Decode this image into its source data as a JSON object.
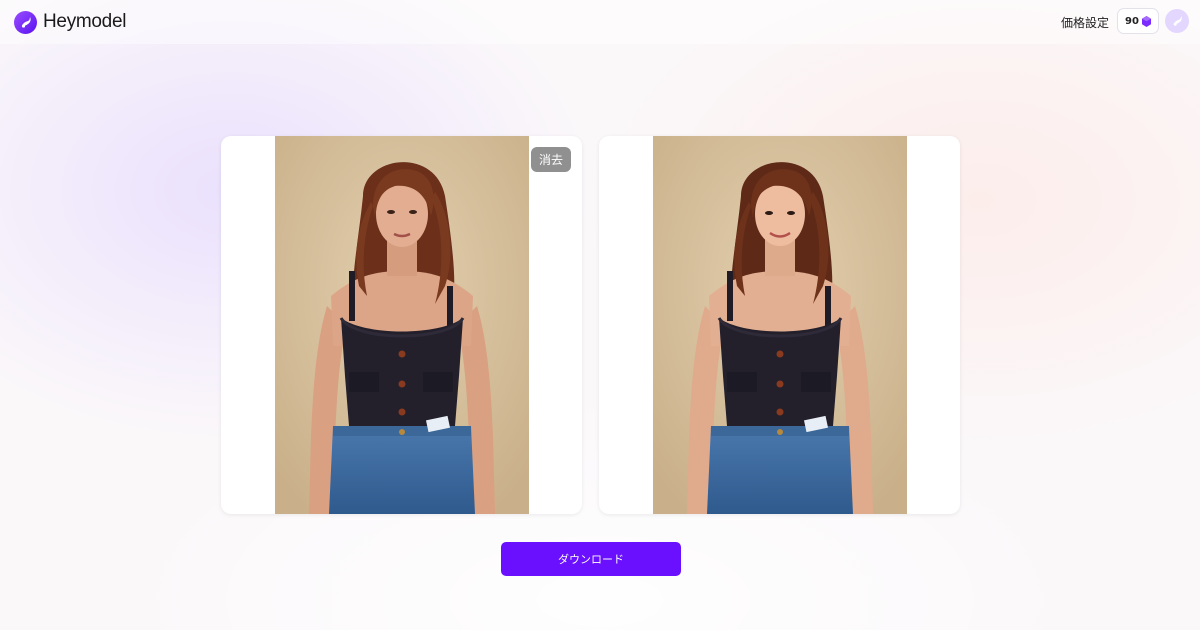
{
  "header": {
    "logo_text": "Heymodel",
    "pricing_label": "価格設定",
    "credits": "90",
    "icons": {
      "logo": "brand-logo-icon",
      "credit": "gem-icon",
      "avatar": "avatar-icon"
    }
  },
  "editor": {
    "original_image_alt": "Model wearing black tank top and jeans (original)",
    "result_image_alt": "Model wearing black tank top and jeans (result)",
    "delete_label": "消去"
  },
  "actions": {
    "download_label": "ダウンロード"
  },
  "colors": {
    "accent": "#6a10ff",
    "logo_gradient_start": "#9a4dff",
    "logo_gradient_end": "#5b12f0",
    "delete_button_bg": "#787878"
  }
}
